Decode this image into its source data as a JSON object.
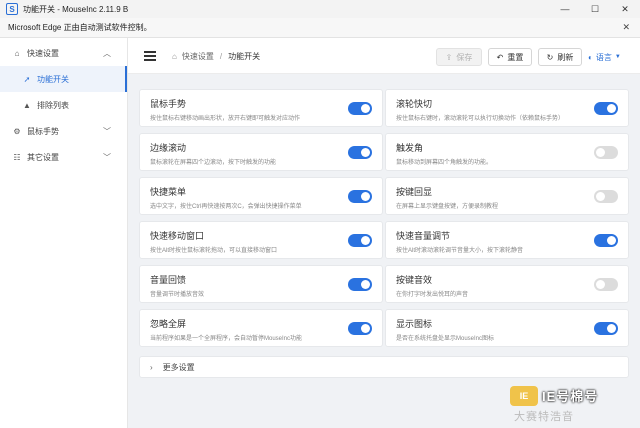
{
  "window": {
    "app_icon_text": "S",
    "title": "功能开关 - MouseInc 2.11.9 B",
    "controls": [
      "—",
      "☐",
      "✕"
    ]
  },
  "infobar": {
    "text": "Microsoft Edge 正由自动测试软件控制。",
    "close": "✕"
  },
  "sidebar": {
    "items": [
      {
        "icon": "⌂",
        "label": "快速设置",
        "chevron": "︿"
      },
      {
        "icon": "➚",
        "label": "功能开关"
      },
      {
        "icon": "▲",
        "label": "排除列表"
      },
      {
        "icon": "⚙",
        "label": "鼠标手势",
        "chevron": "﹀"
      },
      {
        "icon": "☷",
        "label": "其它设置",
        "chevron": "﹀"
      }
    ]
  },
  "toolbar": {
    "breadcrumb_home": "快速设置",
    "breadcrumb_sep": "/",
    "breadcrumb_current": "功能开关",
    "save": "保存",
    "reset": "重置",
    "refresh": "刷新",
    "language": "语言",
    "accent": "#2a6fd6"
  },
  "cards": [
    {
      "title": "鼠标手势",
      "desc": "按住鼠标右键移动画出形状，放开右键即可触发对应动作",
      "on": true
    },
    {
      "title": "滚轮快切",
      "desc": "按住鼠标右键时，滚动滚轮可以执行切换动作（依赖鼠标手势）",
      "on": true
    },
    {
      "title": "边缘滚动",
      "desc": "鼠标滚轮在屏幕四个边滚动，按下时触发的功能",
      "on": true
    },
    {
      "title": "触发角",
      "desc": "鼠标移动到屏幕四个角触发的功能。",
      "on": false
    },
    {
      "title": "快捷菜单",
      "desc": "选中文字，按住Ctrl再快速按两次C，会弹出快捷操作菜单",
      "on": true
    },
    {
      "title": "按键回显",
      "desc": "在屏幕上显示键盘按键，方便录制教程",
      "on": false
    },
    {
      "title": "快速移动窗口",
      "desc": "按住Alt时按住鼠标滚轮拖动，可以直接移动窗口",
      "on": true
    },
    {
      "title": "快速音量调节",
      "desc": "按住Alt时滚动滚轮调节音量大小，按下滚轮静音",
      "on": true
    },
    {
      "title": "音量回馈",
      "desc": "音量调节时播放音效",
      "on": true
    },
    {
      "title": "按键音效",
      "desc": "在你打字时发出悦耳的声音",
      "on": false
    },
    {
      "title": "忽略全屏",
      "desc": "当前程序如果是一个全屏程序，会自动暂停MouseInc功能",
      "on": true
    },
    {
      "title": "显示图标",
      "desc": "是否在系统托盘处显示MouseInc图标",
      "on": true
    }
  ],
  "more_settings": "更多设置",
  "watermark": {
    "logo": "IE",
    "brand": "IE号棉号",
    "sub": "大赛特浩音"
  }
}
